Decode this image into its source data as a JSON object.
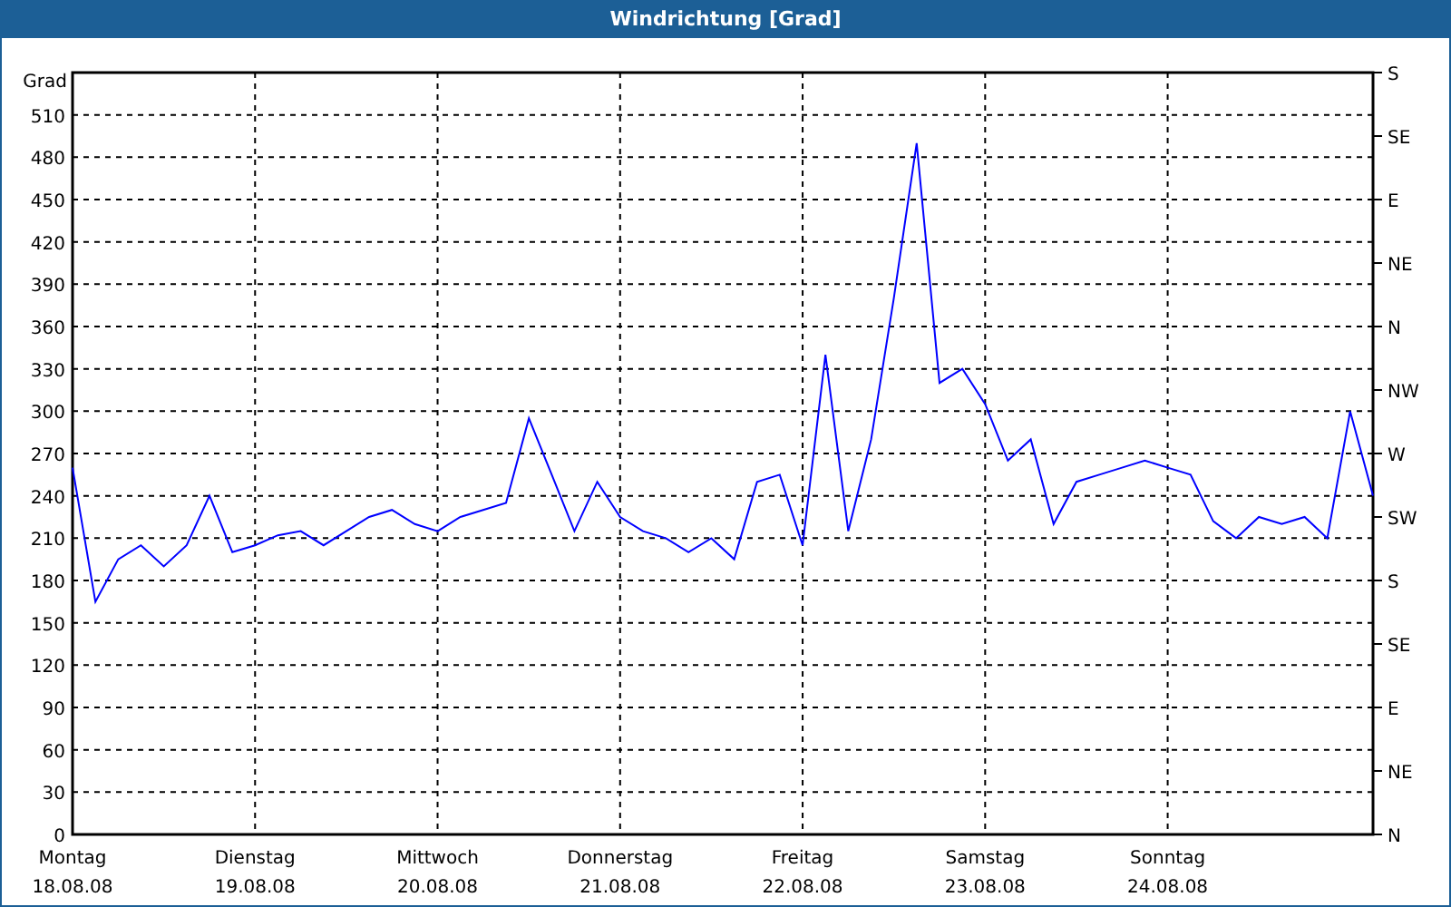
{
  "window": {
    "title": "Windrichtung [Grad]"
  },
  "chart": {
    "chart_data": {
      "type": "line",
      "ylabel": "Grad",
      "categories": [
        "Montag",
        null,
        null,
        null,
        null,
        null,
        null,
        null,
        "Dienstag",
        null,
        null,
        null,
        null,
        null,
        null,
        null,
        "Mittwoch",
        null,
        null,
        null,
        null,
        null,
        null,
        null,
        "Donnerstag",
        null,
        null,
        null,
        null,
        null,
        null,
        null,
        "Freitag",
        null,
        null,
        null,
        null,
        null,
        null,
        null,
        "Samstag",
        null,
        null,
        null,
        null,
        null,
        null,
        null,
        "Sonntag",
        null,
        null,
        null,
        null,
        null,
        null,
        null,
        null,
        null
      ],
      "series": [
        {
          "color": "#0000ff",
          "values": [
            260,
            165,
            195,
            205,
            190,
            205,
            240,
            200,
            205,
            212,
            215,
            205,
            215,
            225,
            230,
            220,
            215,
            225,
            230,
            235,
            295,
            255,
            215,
            250,
            225,
            215,
            210,
            200,
            210,
            195,
            250,
            255,
            205,
            340,
            215,
            280,
            380,
            490,
            320,
            330,
            305,
            265,
            280,
            220,
            250,
            255,
            260,
            265,
            260,
            255,
            222,
            210,
            225,
            220,
            225,
            210,
            300,
            240
          ]
        }
      ],
      "ylim": [
        0,
        540
      ],
      "grid": true,
      "yticks": [
        0,
        30,
        60,
        90,
        120,
        150,
        180,
        210,
        240,
        270,
        300,
        330,
        360,
        390,
        420,
        450,
        480,
        510
      ]
    },
    "dates": [
      "18.08.08",
      "19.08.08",
      "20.08.08",
      "21.08.08",
      "22.08.08",
      "23.08.08",
      "24.08.08"
    ],
    "direction_labels": [
      "S",
      "SE",
      "E",
      "NE",
      "N",
      "NW",
      "W",
      "SW",
      "S",
      "SE",
      "E",
      "NE",
      "N"
    ]
  }
}
